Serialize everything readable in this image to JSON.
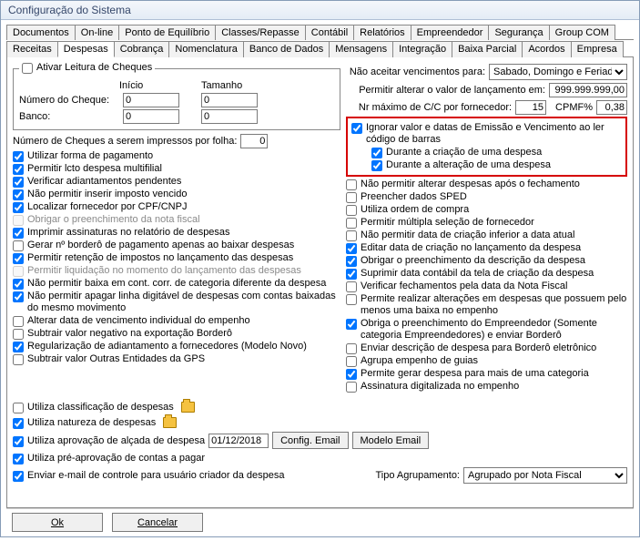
{
  "window": {
    "title": "Configuração do Sistema"
  },
  "tabs1": [
    "Documentos",
    "On-line",
    "Ponto de Equilíbrio",
    "Classes/Repasse",
    "Contábil",
    "Relatórios",
    "Empreendedor",
    "Segurança",
    "Group COM"
  ],
  "tabs2": [
    "Receitas",
    "Despesas",
    "Cobrança",
    "Nomenclatura",
    "Banco de Dados",
    "Mensagens",
    "Integração",
    "Baixa Parcial",
    "Acordos",
    "Empresa"
  ],
  "active_tab": "Despesas",
  "cheque_group": {
    "title": "Ativar Leitura de Cheques",
    "inicio_h": "Início",
    "tamanho_h": "Tamanho",
    "numero_lbl": "Número do Cheque:",
    "banco_lbl": "Banco:",
    "numero_ini": "0",
    "numero_tam": "0",
    "banco_ini": "0",
    "banco_tam": "0"
  },
  "cheques_folha": {
    "label": "Número de Cheques a serem impressos por folha:",
    "value": "0"
  },
  "left_checks": [
    {
      "c": true,
      "t": "Utilizar forma de pagamento"
    },
    {
      "c": true,
      "t": "Permitir lcto despesa multifilial"
    },
    {
      "c": true,
      "t": "Verificar adiantamentos pendentes"
    },
    {
      "c": true,
      "t": "Não permitir inserir imposto vencido"
    },
    {
      "c": true,
      "t": "Localizar fornecedor por CPF/CNPJ"
    },
    {
      "c": false,
      "t": "Obrigar o preenchimento da nota fiscal",
      "d": true
    },
    {
      "c": true,
      "t": "Imprimir assinaturas no relatório de despesas"
    },
    {
      "c": false,
      "t": "Gerar nº borderô de pagamento apenas ao baixar despesas"
    },
    {
      "c": true,
      "t": "Permitir retenção de impostos no lançamento das despesas"
    },
    {
      "c": false,
      "t": "Permitir liquidação no momento do lançamento das despesas",
      "d": true
    },
    {
      "c": true,
      "t": "Não permitir baixa em cont. corr. de categoria diferente da despesa"
    },
    {
      "c": true,
      "t": "Não permitir apagar linha digitável de despesas com contas baixadas do mesmo movimento"
    },
    {
      "c": false,
      "t": "Alterar data de vencimento individual do empenho"
    },
    {
      "c": false,
      "t": "Subtrair valor negativo na exportação Borderô"
    },
    {
      "c": true,
      "t": "Regularização de adiantamento a fornecedores (Modelo Novo)"
    },
    {
      "c": false,
      "t": "Subtrair valor Outras Entidades da GPS"
    }
  ],
  "right_top": {
    "nao_aceitar": "Não aceitar vencimentos para:",
    "nao_aceitar_val": "Sabado, Domingo e Feriado",
    "permitir_alterar": "Permitir alterar o valor de lançamento em:",
    "permitir_alterar_val": "999.999.999,00",
    "nr_max": "Nr máximo de C/C por fornecedor:",
    "nr_max_val": "15",
    "cpmf_lbl": "CPMF%",
    "cpmf_val": "0,38"
  },
  "emph": {
    "main": "Ignorar valor e datas de Emissão e Vencimento ao ler código de barras",
    "sub1": "Durante a criação de uma despesa",
    "sub2": "Durante a alteração de uma despesa"
  },
  "right_checks": [
    {
      "c": false,
      "t": "Não permitir alterar despesas após o fechamento"
    },
    {
      "c": false,
      "t": "Preencher dados SPED"
    },
    {
      "c": false,
      "t": "Utiliza ordem de compra"
    },
    {
      "c": false,
      "t": "Permitir múltipla seleção de fornecedor"
    },
    {
      "c": false,
      "t": "Não permitir data de criação inferior a data atual"
    },
    {
      "c": true,
      "t": "Editar data de criação no lançamento da despesa"
    },
    {
      "c": true,
      "t": "Obrigar o preenchimento da descrição da despesa"
    },
    {
      "c": true,
      "t": "Suprimir data contábil da tela de criação da despesa"
    },
    {
      "c": false,
      "t": "Verificar fechamentos pela data da Nota Fiscal"
    },
    {
      "c": false,
      "t": "Permite realizar alterações em despesas que possuem pelo menos uma baixa no empenho"
    },
    {
      "c": true,
      "t": "Obriga o preenchimento do Empreendedor (Somente categoria Empreendedores) e enviar Borderô"
    },
    {
      "c": false,
      "t": "Enviar descrição de despesa para Borderô eletrônico"
    },
    {
      "c": false,
      "t": "Agrupa empenho de guias"
    },
    {
      "c": true,
      "t": "Permite gerar despesa para mais de uma categoria"
    },
    {
      "c": false,
      "t": "Assinatura digitalizada no empenho"
    }
  ],
  "bottom": {
    "classif": "Utiliza classificação de despesas",
    "natureza": "Utiliza natureza de despesas",
    "aprov": "Utiliza aprovação de alçada de despesa",
    "aprov_date": "01/12/2018",
    "config_email": "Config. Email",
    "modelo_email": "Modelo Email",
    "preaprov": "Utiliza pré-aprovação de contas a pagar",
    "email_ctrl": "Enviar e-mail de controle para usuário criador da despesa",
    "tipo_agr_lbl": "Tipo Agrupamento:",
    "tipo_agr_val": "Agrupado por Nota Fiscal"
  },
  "buttons": {
    "ok": "Ok",
    "cancel": "Cancelar"
  }
}
